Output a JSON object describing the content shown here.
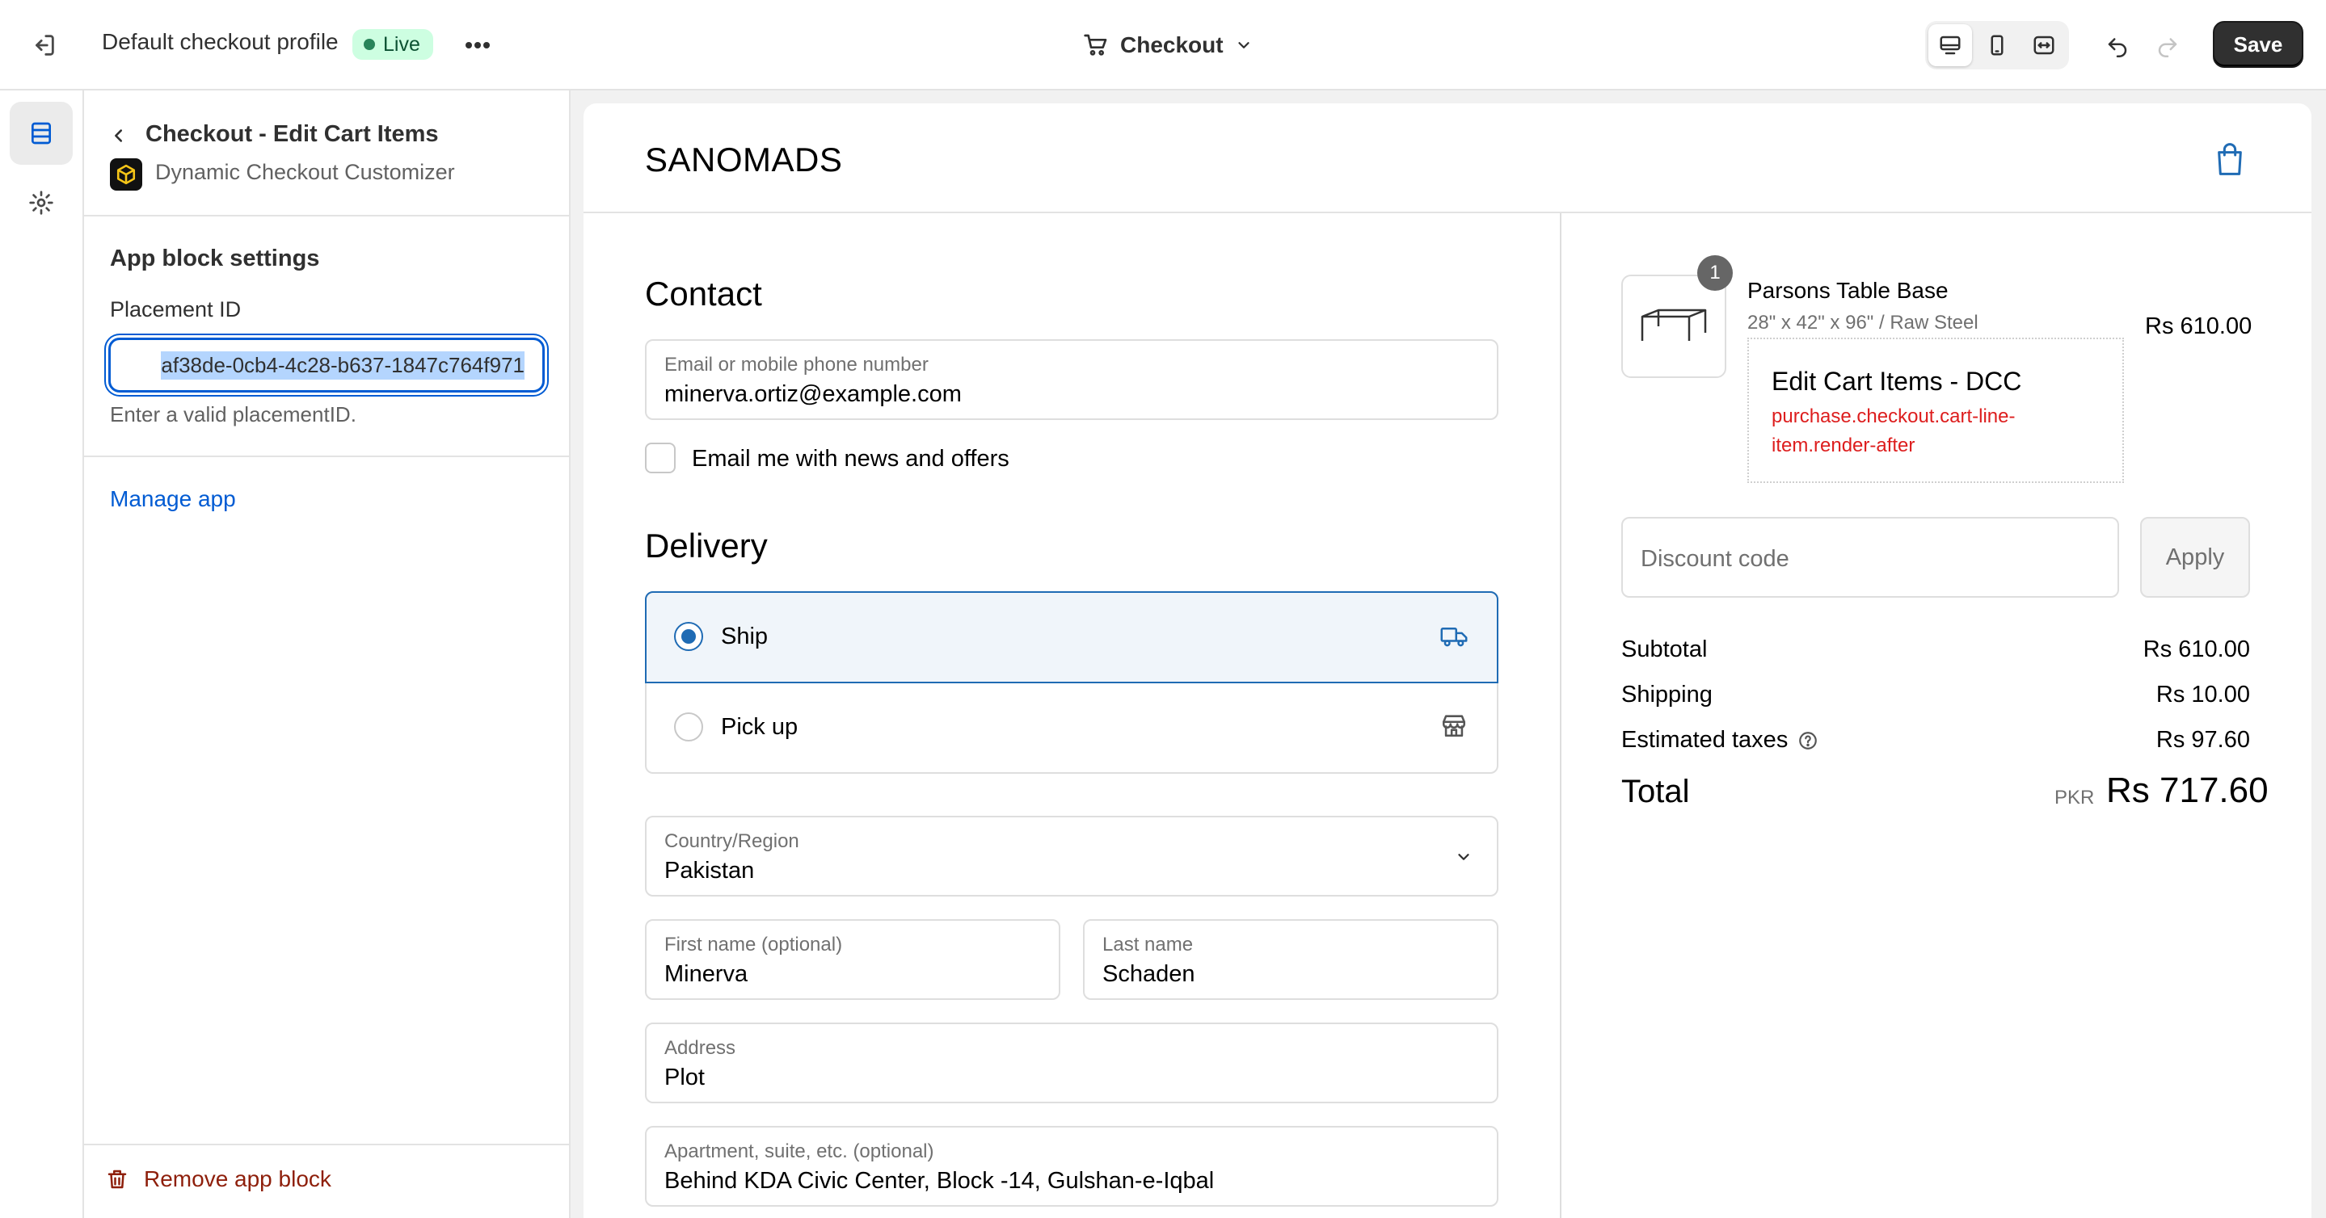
{
  "topbar": {
    "profile_name": "Default checkout profile",
    "status_badge": "Live",
    "page_selector": "Checkout",
    "save_label": "Save"
  },
  "panel": {
    "title": "Checkout - Edit Cart Items",
    "app_name": "Dynamic Checkout Customizer",
    "section_title": "App block settings",
    "placement_label": "Placement ID",
    "placement_value": "af38de-0cb4-4c28-b637-1847c764f971",
    "help_text": "Enter a valid placementID.",
    "manage_app": "Manage app",
    "remove_block": "Remove app block"
  },
  "checkout": {
    "store_name": "SANOMADS",
    "contact": {
      "heading": "Contact",
      "email_label": "Email or mobile phone number",
      "email_value": "minerva.ortiz@example.com",
      "newsletter_label": "Email me with news and offers"
    },
    "delivery": {
      "heading": "Delivery",
      "options": [
        "Ship",
        "Pick up"
      ],
      "selected": "Ship",
      "country_label": "Country/Region",
      "country_value": "Pakistan",
      "first_name_label": "First name (optional)",
      "first_name_value": "Minerva",
      "last_name_label": "Last name",
      "last_name_value": "Schaden",
      "address_label": "Address",
      "address_value": "Plot",
      "apartment_label": "Apartment, suite, etc. (optional)",
      "apartment_value": "Behind KDA Civic Center, Block -14, Gulshan-e-Iqbal"
    }
  },
  "summary": {
    "item": {
      "quantity": "1",
      "name": "Parsons Table Base",
      "variant": "28\" x 42\" x 96\" / Raw Steel",
      "price": "Rs 610.00"
    },
    "extension": {
      "title": "Edit Cart Items - DCC",
      "target": "purchase.checkout.cart-line-item.render-after"
    },
    "discount_placeholder": "Discount code",
    "apply_label": "Apply",
    "subtotal_label": "Subtotal",
    "subtotal_value": "Rs 610.00",
    "shipping_label": "Shipping",
    "shipping_value": "Rs 10.00",
    "taxes_label": "Estimated taxes",
    "taxes_value": "Rs 97.60",
    "total_label": "Total",
    "total_currency": "PKR",
    "total_value": "Rs 717.60"
  },
  "colors": {
    "accent_blue": "#005bd3",
    "live_green": "#29845a",
    "checkout_blue": "#1f6bb4",
    "danger_red": "#8e1f0b",
    "target_red": "#dd1d1d"
  }
}
